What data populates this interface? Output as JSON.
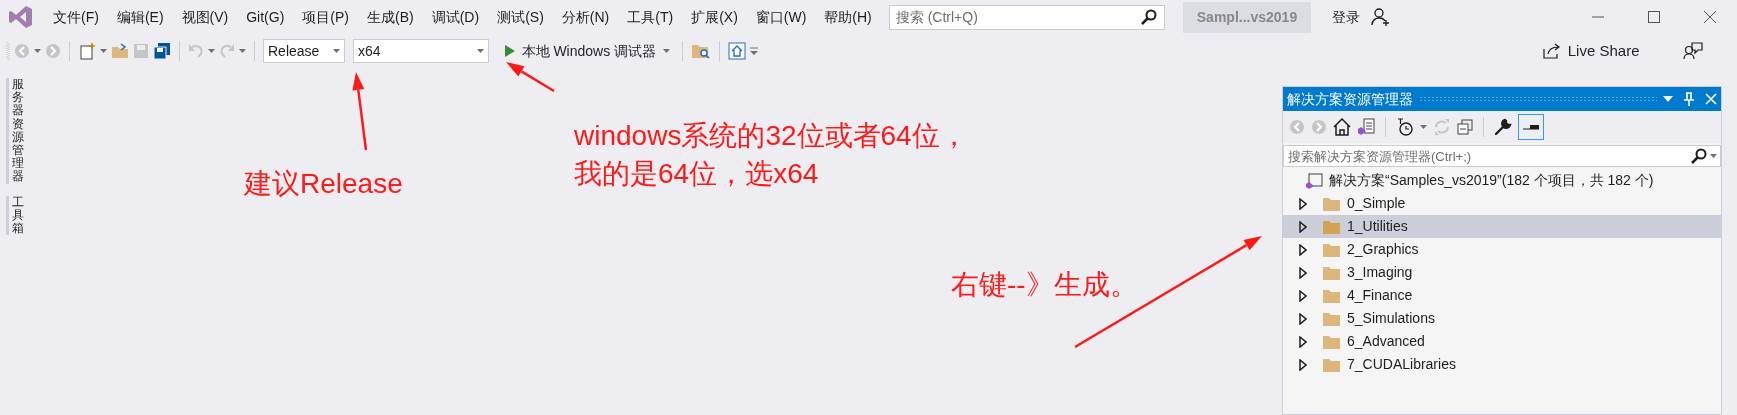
{
  "menu": [
    "文件(F)",
    "编辑(E)",
    "视图(V)",
    "Git(G)",
    "项目(P)",
    "生成(B)",
    "调试(D)",
    "测试(S)",
    "分析(N)",
    "工具(T)",
    "扩展(X)",
    "窗口(W)",
    "帮助(H)"
  ],
  "search": {
    "placeholder": "搜索 (Ctrl+Q)"
  },
  "solution_badge": "Sampl...vs2019",
  "login": "登录",
  "toolbar": {
    "configuration": "Release",
    "platform": "x64",
    "run_label": "本地 Windows 调试器",
    "live_share": "Live Share"
  },
  "side_tabs": [
    "服务器资源管理器",
    "工具箱"
  ],
  "solution_explorer": {
    "title": "解决方案资源管理器",
    "preview_toggle_on": true,
    "search": {
      "placeholder": "搜索解决方案资源管理器(Ctrl+;)"
    },
    "root": "解决方案“Samples_vs2019”(182 个项目，共 182 个)",
    "items": [
      {
        "label": "0_Simple",
        "expanded": false,
        "selected": false
      },
      {
        "label": "1_Utilities",
        "expanded": false,
        "selected": true
      },
      {
        "label": "2_Graphics",
        "expanded": false,
        "selected": false
      },
      {
        "label": "3_Imaging",
        "expanded": false,
        "selected": false
      },
      {
        "label": "4_Finance",
        "expanded": false,
        "selected": false
      },
      {
        "label": "5_Simulations",
        "expanded": false,
        "selected": false
      },
      {
        "label": "6_Advanced",
        "expanded": false,
        "selected": false
      },
      {
        "label": "7_CUDALibraries",
        "expanded": false,
        "selected": false
      }
    ]
  },
  "annotations": [
    {
      "text": "建议Release"
    },
    {
      "text": "windows系统的32位或者64位，"
    },
    {
      "text": "我的是64位，选x64"
    },
    {
      "text": "右键--》生成。"
    }
  ]
}
